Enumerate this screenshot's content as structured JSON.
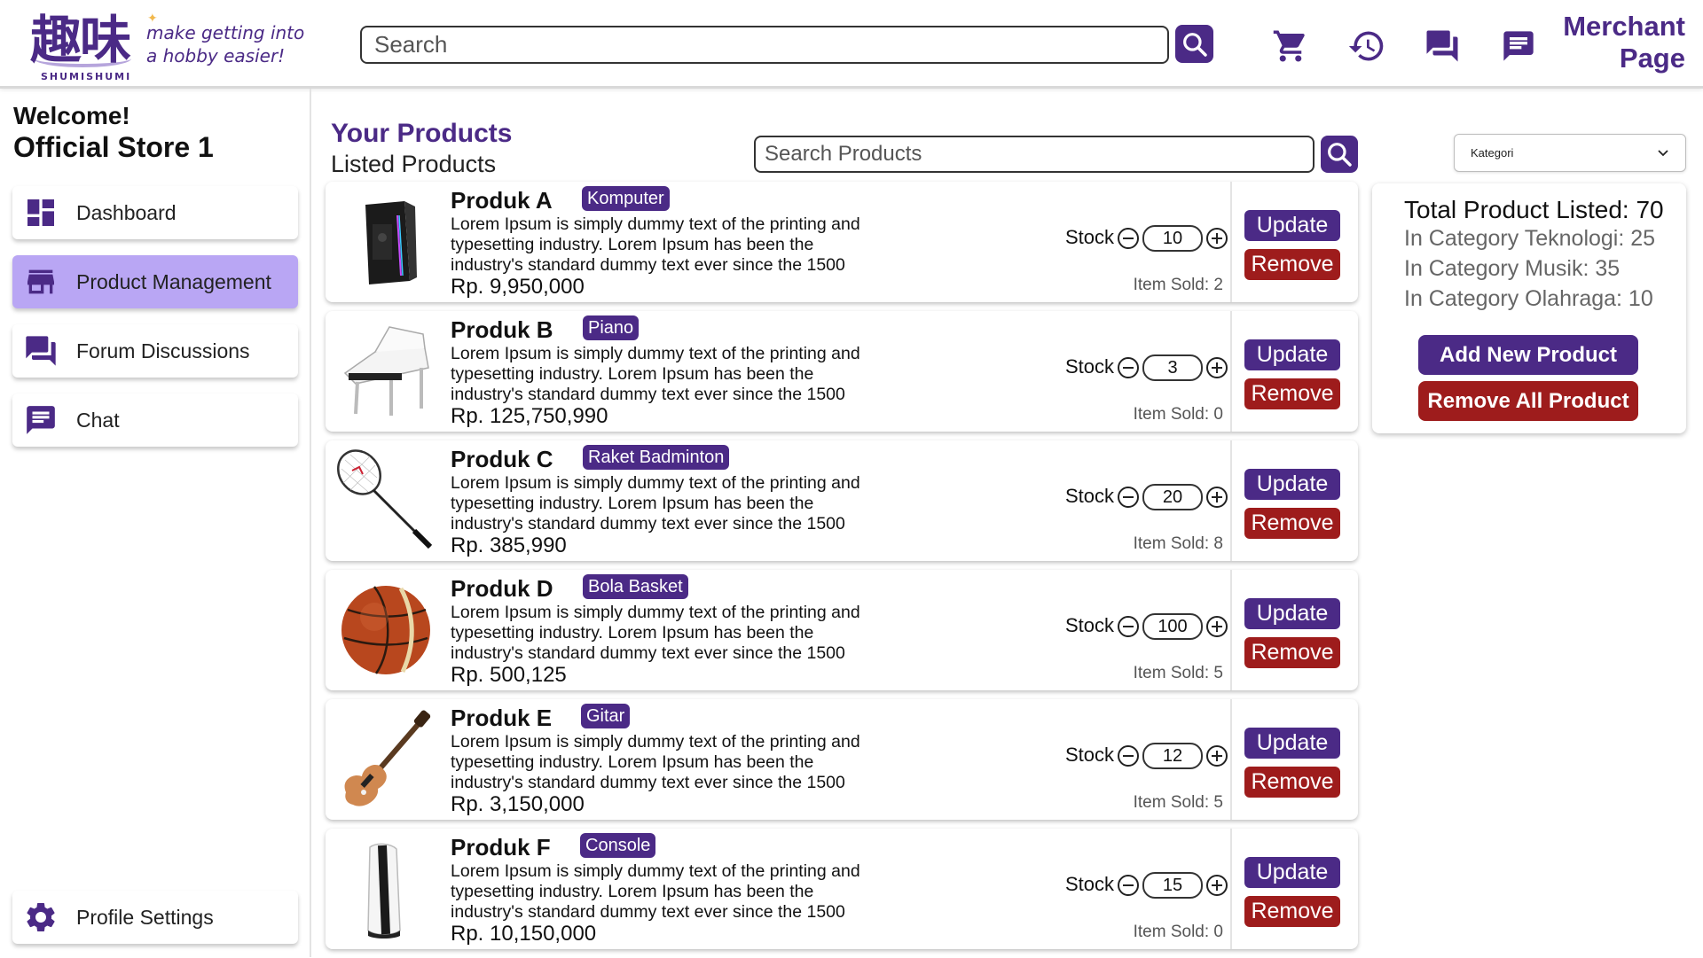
{
  "colors": {
    "primary": "#4b2a86",
    "danger": "#9e1c1c",
    "active_nav": "#b9a6f4",
    "muted_text": "#666666"
  },
  "header": {
    "logo_kanji": "趣味",
    "logo_wordmark": "SHUMISHUMI",
    "tagline_line1": "make getting into",
    "tagline_line2": "a hobby easier!",
    "search_placeholder": "Search",
    "merchant_line1": "Merchant",
    "merchant_line2": "Page",
    "icons": [
      "search-icon",
      "cart-icon",
      "history-icon",
      "forum-icon",
      "chat-icon"
    ]
  },
  "sidebar": {
    "welcome": "Welcome!",
    "store_name": "Official Store 1",
    "items": [
      {
        "label": "Dashboard",
        "icon": "dashboard-icon",
        "active": false
      },
      {
        "label": "Product Management",
        "icon": "store-icon",
        "active": true
      },
      {
        "label": "Forum Discussions",
        "icon": "forum-icon",
        "active": false
      },
      {
        "label": "Chat",
        "icon": "chat-icon",
        "active": false
      }
    ],
    "profile_settings": {
      "label": "Profile Settings",
      "icon": "gear-icon"
    }
  },
  "main": {
    "title": "Your Products",
    "subtitle": "Listed Products",
    "search_placeholder": "Search Products",
    "category_dropdown": "Kategori"
  },
  "products": [
    {
      "name": "Produk A",
      "category": "Komputer",
      "description": "Lorem Ipsum is simply dummy text of the printing and typesetting industry. Lorem Ipsum has been the industry's standard dummy text ever since the 1500",
      "price": "Rp. 9,950,000",
      "stock_label": "Stock",
      "stock": "10",
      "sold": "Item Sold: 2",
      "image": "pc-tower-image"
    },
    {
      "name": "Produk B",
      "category": "Piano",
      "description": "Lorem Ipsum is simply dummy text of the printing and typesetting industry. Lorem Ipsum has been the industry's standard dummy text ever since the 1500",
      "price": "Rp. 125,750,990",
      "stock_label": "Stock",
      "stock": "3",
      "sold": "Item Sold: 0",
      "image": "piano-image"
    },
    {
      "name": "Produk C",
      "category": "Raket Badminton",
      "description": "Lorem Ipsum is simply dummy text of the printing and typesetting industry. Lorem Ipsum has been the industry's standard dummy text ever since the 1500",
      "price": "Rp. 385,990",
      "stock_label": "Stock",
      "stock": "20",
      "sold": "Item Sold: 8",
      "image": "badminton-racket-image"
    },
    {
      "name": "Produk D",
      "category": "Bola Basket",
      "description": "Lorem Ipsum is simply dummy text of the printing and typesetting industry. Lorem Ipsum has been the industry's standard dummy text ever since the 1500",
      "price": "Rp. 500,125",
      "stock_label": "Stock",
      "stock": "100",
      "sold": "Item Sold: 5",
      "image": "basketball-image"
    },
    {
      "name": "Produk E",
      "category": "Gitar",
      "description": "Lorem Ipsum is simply dummy text of the printing and typesetting industry. Lorem Ipsum has been the industry's standard dummy text ever since the 1500",
      "price": "Rp. 3,150,000",
      "stock_label": "Stock",
      "stock": "12",
      "sold": "Item Sold: 5",
      "image": "guitar-image"
    },
    {
      "name": "Produk F",
      "category": "Console",
      "description": "Lorem Ipsum is simply dummy text of the printing and typesetting industry. Lorem Ipsum has been the industry's standard dummy text ever since the 1500",
      "price": "Rp. 10,150,000",
      "stock_label": "Stock",
      "stock": "15",
      "sold": "Item Sold: 0",
      "image": "console-image"
    }
  ],
  "buttons": {
    "update": "Update",
    "remove": "Remove"
  },
  "summary": {
    "total": "Total Product Listed: 70",
    "categories": [
      "In Category Teknologi: 25",
      "In Category Musik: 35",
      "In Category Olahraga: 10"
    ],
    "add_button": "Add New Product",
    "remove_all_button": "Remove All Product"
  }
}
